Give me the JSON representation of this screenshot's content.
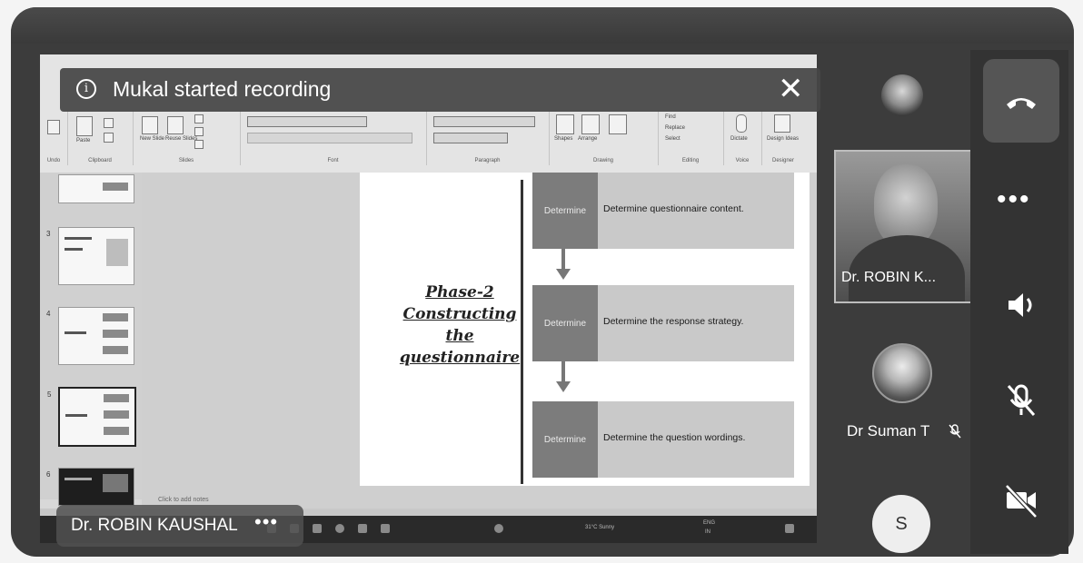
{
  "banner": {
    "message": "Mukal started recording"
  },
  "presenter": {
    "name": "Dr. ROBIN KAUSHAL",
    "more_label": "•••"
  },
  "slide": {
    "phase_title": [
      "Phase-2",
      "Constructing",
      "the",
      "questionnaire"
    ],
    "steps": [
      {
        "tag": "Determine",
        "text": "Determine questionnaire content."
      },
      {
        "tag": "Determine",
        "text": "Determine the response strategy."
      },
      {
        "tag": "Determine",
        "text": "Determine the question wordings."
      }
    ],
    "thumb_numbers": [
      "3",
      "4",
      "5",
      "6"
    ],
    "notes_placeholder": "Click to add notes"
  },
  "ribbon": {
    "groups": [
      "Undo",
      "Clipboard",
      "Slides",
      "Font",
      "Paragraph",
      "Drawing",
      "Editing",
      "Voice",
      "Designer"
    ],
    "buttons": [
      "Paste",
      "New Slide",
      "Reuse Slides",
      "Shapes",
      "Arrange",
      "Dictate",
      "Design Ideas"
    ],
    "editing_items": [
      "Find",
      "Replace",
      "Select"
    ]
  },
  "taskbar": {
    "weather": "31°C Sunny",
    "lang": "ENG",
    "region": "IN"
  },
  "participants": {
    "tile_name": "Dr. ROBIN K...",
    "suman_name": "Dr Suman T",
    "initial": "S"
  },
  "controls": {
    "more_label": "•••"
  }
}
